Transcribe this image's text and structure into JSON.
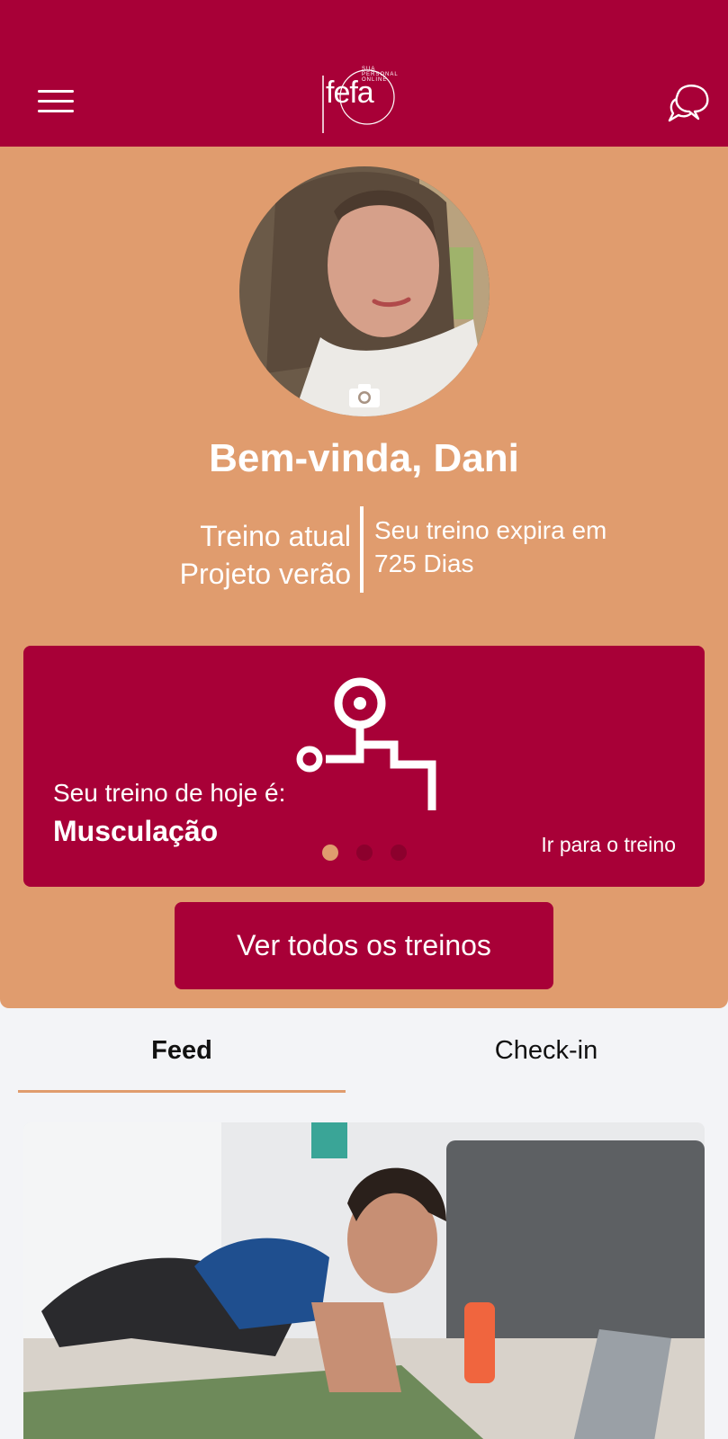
{
  "header": {
    "logo": {
      "wordmark": "fefa",
      "tagline": "SUA PERSONAL ONLINE"
    },
    "menu_icon": "hamburger-menu-icon",
    "chat_icon": "chat-bubbles-icon"
  },
  "profile": {
    "greeting": "Bem-vinda, Dani",
    "current_workout_label": "Treino atual",
    "current_workout_name": "Projeto verão",
    "expiry_label": "Seu treino expira em",
    "expiry_value": "725 Dias"
  },
  "today_card": {
    "label": "Seu treino de hoje é:",
    "workout": "Musculação",
    "link": "Ir para o treino",
    "icon": "bench-press-icon",
    "carousel_active_index": 0,
    "carousel_count": 3
  },
  "all_workouts_button": "Ver todos os treinos",
  "tabs": [
    {
      "label": "Feed",
      "active": true
    },
    {
      "label": "Check-in",
      "active": false
    }
  ],
  "colors": {
    "primary": "#a80037",
    "accent": "#e09c6e",
    "background": "#f3f4f7"
  }
}
